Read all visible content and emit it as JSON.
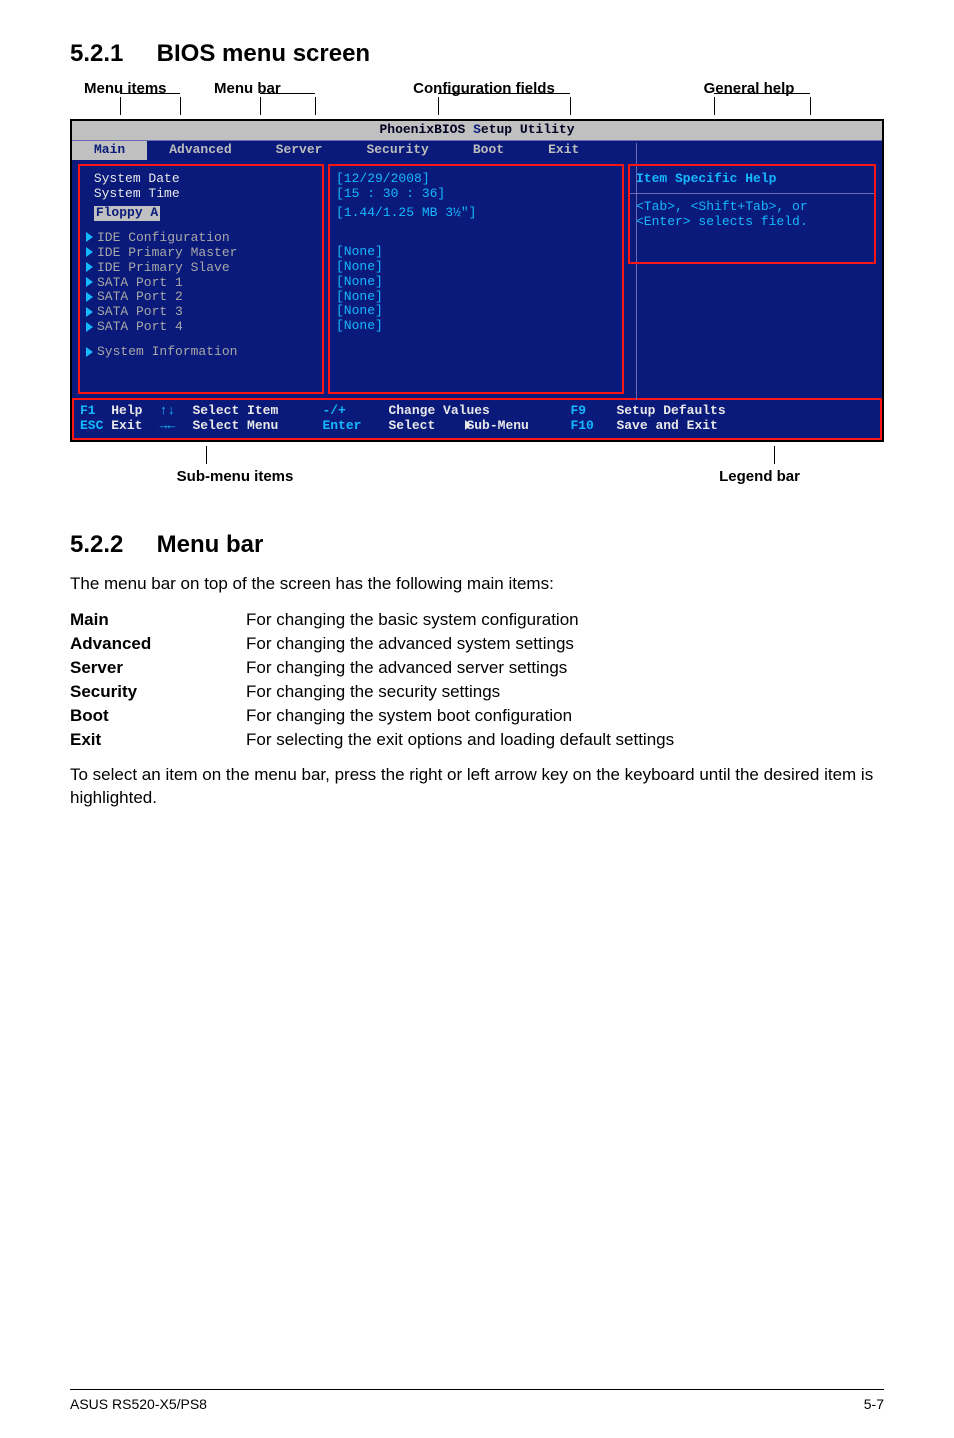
{
  "sec1": {
    "num": "5.2.1",
    "title": "BIOS menu screen"
  },
  "annot": {
    "a1": "Menu items",
    "a2": "Menu bar",
    "a3": "Configuration fields",
    "a4": "General help",
    "sub": "Sub-menu items",
    "legend": "Legend bar"
  },
  "bios": {
    "title_left": "PhoenixBIOS ",
    "title_right": "etup Utility",
    "title_s": "S",
    "tabs": {
      "main": "Main",
      "advanced": "Advanced",
      "server": "Server",
      "security": "Security",
      "boot": "Boot",
      "exit": "Exit"
    },
    "left": {
      "sysdate": "System Date",
      "systime": "System Time",
      "floppy": "Floppy A",
      "items": [
        "IDE Configuration",
        "IDE Primary Master",
        "IDE Primary Slave",
        "SATA Port 1",
        "SATA Port 2",
        "SATA Port 3",
        "SATA Port 4"
      ],
      "sysinfo": "System Information"
    },
    "mid": {
      "date": "[12/29/2008]",
      "time": "[15 : 30 : 36]",
      "floppy": "[1.44/1.25 MB 3½\"]",
      "nones": [
        "[None]",
        "[None]",
        "[None]",
        "[None]",
        "[None]",
        "[None]"
      ]
    },
    "help": {
      "title": "Item Specific Help",
      "text": "<Tab>, <Shift+Tab>, or\n<Enter> selects field."
    },
    "legend": {
      "f1": "F1",
      "help": "Help",
      "up": "↑↓",
      "selitem": "Select Item",
      "pm": "-/+",
      "chval": "Change Values",
      "f9": "F9",
      "setdef": "Setup Defaults",
      "esc": "ESC",
      "exit": "Exit",
      "lr": "→←",
      "selmenu": "Select Menu",
      "enter": "Enter",
      "selsub": "Select    Sub-Menu",
      "f10": "F10",
      "save": "Save and Exit"
    }
  },
  "sec2": {
    "num": "5.2.2",
    "title": "Menu bar"
  },
  "intro": "The menu bar on top of the screen has the following main items:",
  "defs": {
    "main": {
      "t": "Main",
      "d": "For changing the basic system configuration"
    },
    "adv": {
      "t": "Advanced",
      "d": "For changing the advanced system settings"
    },
    "srv": {
      "t": "Server",
      "d": "For changing the advanced server settings"
    },
    "sec": {
      "t": "Security",
      "d": "For changing the security settings"
    },
    "boot": {
      "t": "Boot",
      "d": "For changing the system boot configuration"
    },
    "exit": {
      "t": "Exit",
      "d": "For selecting the exit options and loading default settings"
    }
  },
  "outro": "To select an item on the menu bar, press the right or left arrow key on the keyboard until the desired item is highlighted.",
  "footer": {
    "left": "ASUS RS520-X5/PS8",
    "right": "5-7"
  }
}
